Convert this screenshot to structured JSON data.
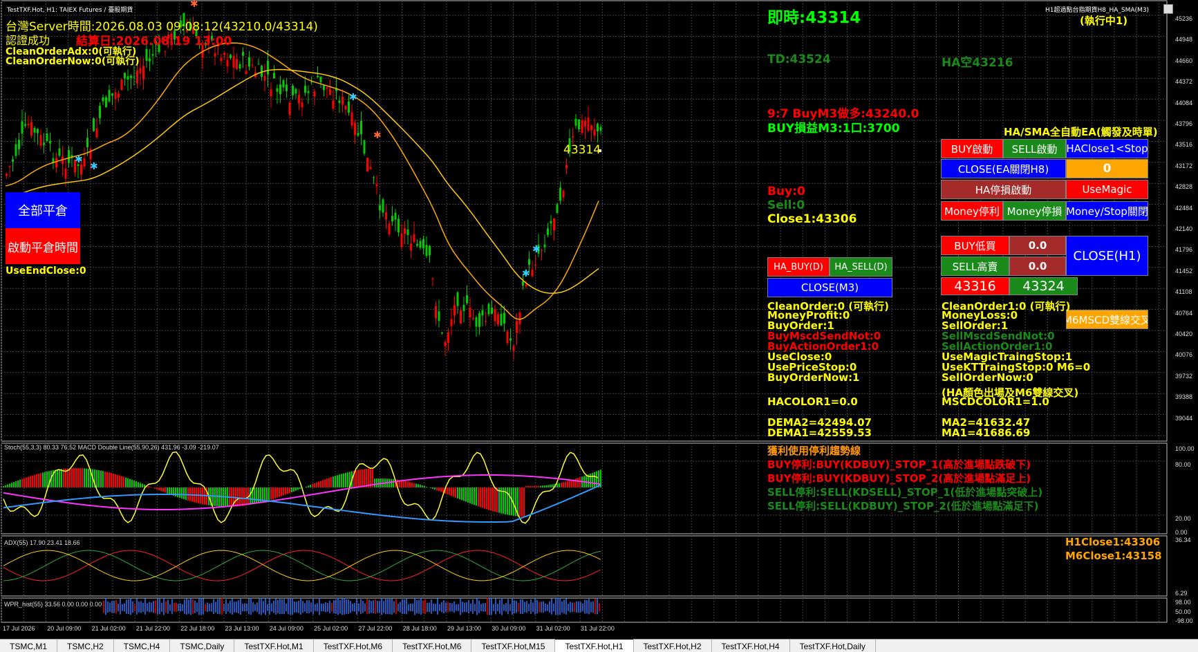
{
  "window": {
    "title": "TestTXF.Hot, H1:  TAIEX Futures / 臺股期貨",
    "ea_name": "H1超過點台指期貨H8_HA_SMA(M3)",
    "running": "(執行中1)"
  },
  "left_info": {
    "server_time": "台灣Server時間:2026.08.03 09:08:12(43210.0/43314)",
    "auth": "認證成功",
    "expire": "結算日:2026.08.19 13:00",
    "clean_adx": "CleanOrderAdx:0(可執行)",
    "clean_now": "CleanOrderNow:0(可執行)",
    "use_end_close": "UseEndClose:0"
  },
  "left_buttons": {
    "close_all": "全部平倉",
    "start_close_time": "啟動平倉時間"
  },
  "price_tag": "43314",
  "right_info": {
    "realtime": "即時:43314",
    "td": "TD:43524",
    "ha_sell": "HA空43216",
    "buy_m3": "9:7 BuyM3做多:43240.0",
    "buy_pl": "BUY損益M3:1口:3700",
    "buy": "Buy:0",
    "sell": "Sell:0",
    "close1": "Close1:43306",
    "panel_title": "HA/SMA全自動EA(觸發及時單)"
  },
  "panel_buttons": {
    "buy_start": "BUY啟動",
    "sell_start": "SELL啟動",
    "ha_close": "HAClose1<Stop",
    "close_ea": "CLOSE(EA關閉H8)",
    "zero": "0",
    "ha_stop": "HA停損啟動",
    "use_magic": "UseMagic",
    "money_profit": "Money停利",
    "money_loss": "Money停損",
    "money_stop_close": "Money/Stop關閉",
    "buy_low": "BUY低買",
    "buy_low_val": "0.0",
    "sell_high": "SELL高賣",
    "sell_high_val": "0.0",
    "close_h1": "CLOSE(H1)",
    "price1": "43316",
    "price2": "43324",
    "ha_buy_d": "HA_BUY(D)",
    "ha_sell_d": "HA_SELL(D)",
    "close_m3": "CLOSE(M3)",
    "m6mscd": "M6MSCD雙線交叉"
  },
  "stats_left": [
    {
      "t": "CleanOrder:0 (可執行)",
      "c": "#ffff00"
    },
    {
      "t": "MoneyProfit:0",
      "c": "#ffff00"
    },
    {
      "t": "BuyOrder:1",
      "c": "#ffff00"
    },
    {
      "t": "BuyMscdSendNot:0",
      "c": "#ff0000"
    },
    {
      "t": "BuyActionOrder1:0",
      "c": "#ff0000"
    },
    {
      "t": "UseClose:0",
      "c": "#ffff00"
    },
    {
      "t": "UsePriceStop:0",
      "c": "#ffff00"
    },
    {
      "t": "BuyOrderNow:1",
      "c": "#ffff00"
    }
  ],
  "stats_right": [
    {
      "t": "CleanOrder1:0 (可執行)",
      "c": "#ffff00"
    },
    {
      "t": "MoneyLoss:0",
      "c": "#ffff00"
    },
    {
      "t": "SellOrder:1",
      "c": "#ffff00"
    },
    {
      "t": "SellMscdSendNot:0",
      "c": "#1a8a1a"
    },
    {
      "t": "SellActionOrder1:0",
      "c": "#1a8a1a"
    },
    {
      "t": "UseMagicTraingStop:1",
      "c": "#ffff00"
    },
    {
      "t": "UseKTTraingStop:0  M6=0",
      "c": "#ffff00"
    },
    {
      "t": "SellOrderNow:0",
      "c": "#ffff00"
    }
  ],
  "ha_color_note": "(HA顏色出場及M6雙線交叉)",
  "hacolor": "HACOLOR1=0.0",
  "mscdcolor": "MSCDCOLOR1=1.0",
  "dema2": "DEMA2=42494.07",
  "dema1": "DEMA1=42559.53",
  "ma2": "MA2=41632.47",
  "ma1": "MA1=41686.69",
  "trail_lines": [
    {
      "t": "獲利使用停利趨勢線",
      "c": "#ff9900"
    },
    {
      "t": "BUY停利:BUY(KDBUY)_STOP_1(高於進場點跌破下)",
      "c": "#ff0000"
    },
    {
      "t": "BUY停利:BUY(KDBUY)_STOP_2(高於進場點滿足上)",
      "c": "#ff0000"
    },
    {
      "t": "SELL停利:SELL(KDSELL)_STOP_1(低於進場點突破上)",
      "c": "#1a8a1a"
    },
    {
      "t": "SELL停利:SELL(KDBUY)_STOP_2(低於進場點滿足下)",
      "c": "#1a8a1a"
    }
  ],
  "h1close": "H1Close1:43306",
  "m6close": "M6Close1:43158",
  "sub1_label": "Stoch(55,3,3) 80.33 76.52 MACD Double Line(55,90,26) 431.96 -3.09 -219.07",
  "sub2_label": "ADX(55) 17.90 23.41 18.66",
  "sub3_label": "WPR_hist(55) 33.56 0.00 0.00 0.00",
  "price_axis": [
    "45236",
    "44948",
    "44660",
    "44372",
    "44084",
    "43796",
    "43516",
    "43172",
    "42828",
    "42484",
    "42140",
    "41796",
    "41452",
    "41108",
    "40764",
    "40420",
    "40076",
    "39732",
    "39388",
    "39044"
  ],
  "sub1_axis": [
    "100.00",
    "80.00",
    "20.00",
    "0.00"
  ],
  "sub2_axis": [
    "36.34",
    "6.29"
  ],
  "sub3_axis": [
    "98.00",
    "50.00",
    "-98.00"
  ],
  "time_axis": [
    "17 Jul 2026",
    "20 Jul 09:00",
    "21 Jul 02:00",
    "21 Jul 22:00",
    "22 Jul 18:00",
    "23 Jul 13:00",
    "24 Jul 09:00",
    "25 Jul 02:00",
    "27 Jul 22:00",
    "28 Jul 18:00",
    "29 Jul 13:00",
    "30 Jul 09:00",
    "31 Jul 02:00",
    "31 Jul 22:00"
  ],
  "tabs": [
    "TSMC,M1",
    "TSMC,H2",
    "TSMC,H4",
    "TSMC,Daily",
    "TestTXF.Hot,M1",
    "TestTXF.Hot,M6",
    "TestTXF.Hot,M6",
    "TestTXF.Hot,M15",
    "TestTXF.Hot,H1",
    "TestTXF.Hot,H2",
    "TestTXF.Hot,H4",
    "TestTXF.Hot,Daily"
  ],
  "active_tab": 8,
  "colors": {
    "up": "#ff0000",
    "down": "#00cc00",
    "ma_fast": "#ffcc00",
    "ma_slow": "#ffaa00",
    "grid": "#555"
  }
}
